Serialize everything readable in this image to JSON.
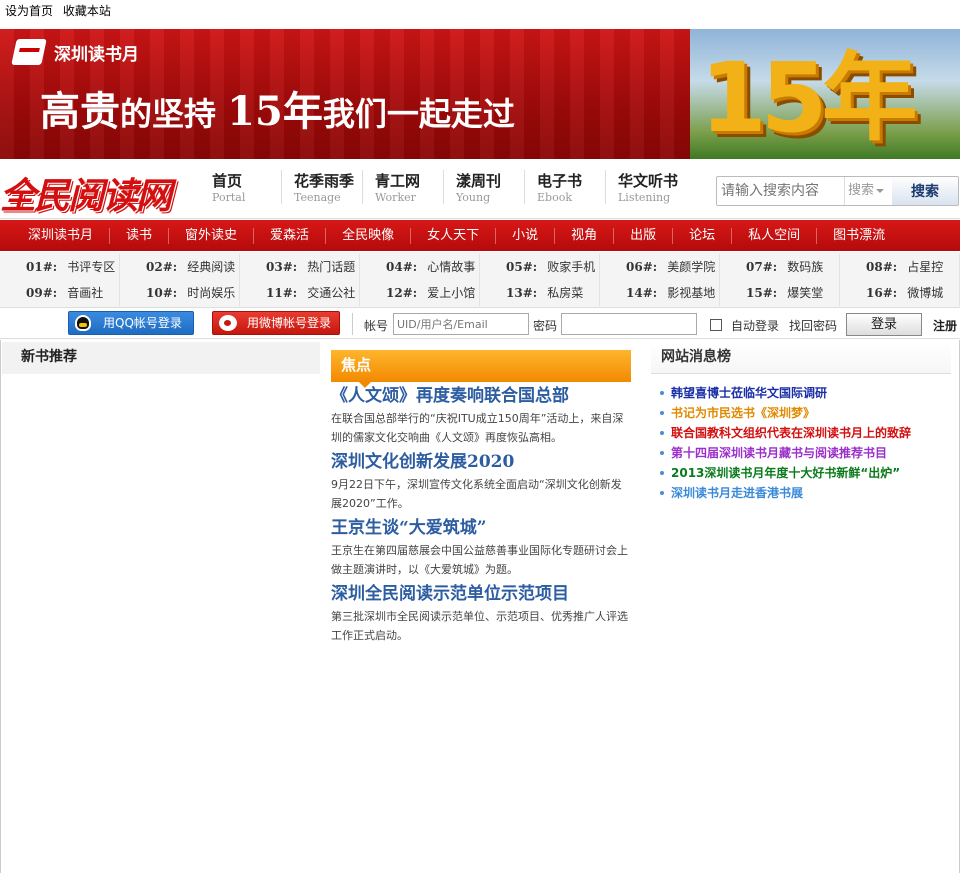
{
  "topbar": {
    "set_home": "设为首页",
    "bookmark": "收藏本站"
  },
  "banner": {
    "brand": "深圳读书月",
    "slogan_part1": "高贵",
    "slogan_part2": "的坚持 ",
    "slogan_part3": "15年",
    "slogan_part4": "我们一起走过",
    "badge": "15年"
  },
  "logo": "全民阅读网",
  "site_nav": [
    {
      "cn": "首页",
      "en": "Portal"
    },
    {
      "cn": "花季雨季",
      "en": "Teenage"
    },
    {
      "cn": "青工网",
      "en": "Worker"
    },
    {
      "cn": "漾周刊",
      "en": "Young"
    },
    {
      "cn": "电子书",
      "en": "Ebook"
    },
    {
      "cn": "华文听书",
      "en": "Listening"
    }
  ],
  "search": {
    "placeholder": "请输入搜索内容",
    "type": "搜索",
    "button": "搜索"
  },
  "channels": [
    "深圳读书月",
    "读书",
    "窗外读史",
    "爱森活",
    "全民映像",
    "女人天下",
    "小说",
    "视角",
    "出版",
    "论坛",
    "私人空间",
    "图书漂流"
  ],
  "numbered_row1": [
    {
      "num": "01#:",
      "label": "书评专区"
    },
    {
      "num": "02#:",
      "label": "经典阅读"
    },
    {
      "num": "03#:",
      "label": "热门话题"
    },
    {
      "num": "04#:",
      "label": "心情故事"
    },
    {
      "num": "05#:",
      "label": "败家手机"
    },
    {
      "num": "06#:",
      "label": "美颜学院"
    },
    {
      "num": "07#:",
      "label": "数码族"
    },
    {
      "num": "08#:",
      "label": "占星控"
    }
  ],
  "numbered_row2": [
    {
      "num": "09#:",
      "label": "音画社"
    },
    {
      "num": "10#:",
      "label": "时尚娱乐"
    },
    {
      "num": "11#:",
      "label": "交通公社"
    },
    {
      "num": "12#:",
      "label": "爱上小馆"
    },
    {
      "num": "13#:",
      "label": "私房菜"
    },
    {
      "num": "14#:",
      "label": "影视基地"
    },
    {
      "num": "15#:",
      "label": "爆笑堂"
    },
    {
      "num": "16#:",
      "label": "微博城"
    }
  ],
  "login": {
    "qq": "用QQ帐号登录",
    "weibo": "用微博帐号登录",
    "account_label": "帐号",
    "account_placeholder": "UID/用户名/Email",
    "password_label": "密码",
    "auto_login": "自动登录",
    "retrieve": "找回密码",
    "login_button": "登录",
    "register": "注册"
  },
  "newbooks": {
    "title": "新书推荐"
  },
  "focus": {
    "title": "焦点",
    "stories": [
      {
        "title": "《人文颂》再度奏响联合国总部",
        "summary": "在联合国总部举行的“庆祝ITU成立150周年”活动上，来自深圳的儒家文化交响曲《人文颂》再度恢弘高相。"
      },
      {
        "title": "深圳文化创新发展2020",
        "summary": "9月22日下午，深圳宣传文化系统全面启动“深圳文化创新发展2020”工作。"
      },
      {
        "title": "王京生谈“大爱筑城”",
        "summary": "王京生在第四届慈展会中国公益慈善事业国际化专题研讨会上做主题演讲时，以《大爱筑城》为题。"
      },
      {
        "title": "深圳全民阅读示范单位示范项目",
        "summary": "第三批深圳市全民阅读示范单位、示范项目、优秀推广人评选工作正式启动。"
      }
    ]
  },
  "news": {
    "title": "网站消息榜",
    "items": [
      {
        "text": "韩望喜博士莅临华文国际调研",
        "color": "#1a2ea8"
      },
      {
        "text": "书记为市民选书《深圳梦》",
        "color": "#e08a00"
      },
      {
        "text": "联合国教科文组织代表在深圳读书月上的致辞",
        "color": "#d30f0f"
      },
      {
        "text": "第十四届深圳读书月藏书与阅读推荐书目",
        "color": "#9b2fc9"
      },
      {
        "text": "2013深圳读书月年度十大好书新鲜“出炉”",
        "color": "#0a7a1a"
      },
      {
        "text": "深圳读书月走进香港书展",
        "color": "#3a8ad9"
      }
    ]
  }
}
